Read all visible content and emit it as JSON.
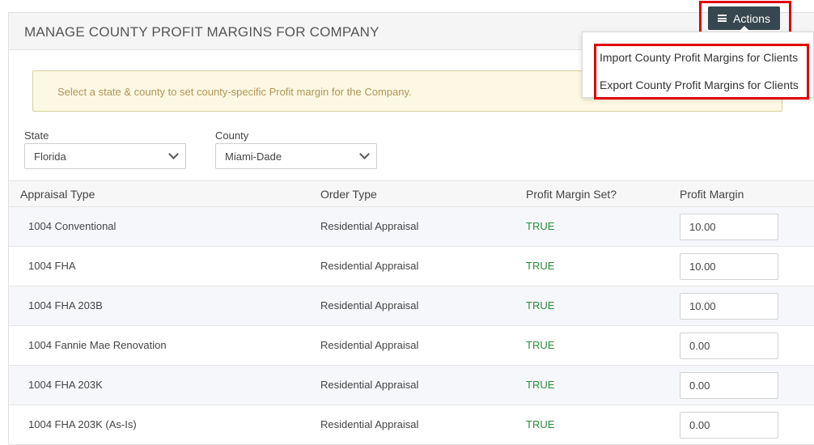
{
  "header": {
    "title": "MANAGE COUNTY PROFIT MARGINS FOR COMPANY",
    "actions_label": "Actions"
  },
  "actions_menu": {
    "items": [
      {
        "label": "Import County Profit Margins for Clients"
      },
      {
        "label": "Export County Profit Margins for Clients"
      }
    ]
  },
  "alert": {
    "text": "Select a state & county to set county-specific Profit margin for the Company."
  },
  "filters": {
    "state_label": "State",
    "state_value": "Florida",
    "county_label": "County",
    "county_value": "Miami-Dade"
  },
  "table": {
    "columns": [
      "Appraisal Type",
      "Order Type",
      "Profit Margin Set?",
      "Profit Margin"
    ],
    "rows": [
      {
        "appraisal_type": "1004 Conventional",
        "order_type": "Residential Appraisal",
        "set": "TRUE",
        "margin": "10.00"
      },
      {
        "appraisal_type": "1004 FHA",
        "order_type": "Residential Appraisal",
        "set": "TRUE",
        "margin": "10.00"
      },
      {
        "appraisal_type": "1004 FHA 203B",
        "order_type": "Residential Appraisal",
        "set": "TRUE",
        "margin": "10.00"
      },
      {
        "appraisal_type": "1004 Fannie Mae Renovation",
        "order_type": "Residential Appraisal",
        "set": "TRUE",
        "margin": "0.00"
      },
      {
        "appraisal_type": "1004 FHA 203K",
        "order_type": "Residential Appraisal",
        "set": "TRUE",
        "margin": "0.00"
      },
      {
        "appraisal_type": "1004 FHA 203K (As-Is)",
        "order_type": "Residential Appraisal",
        "set": "TRUE",
        "margin": "0.00"
      }
    ]
  },
  "colors": {
    "actions_bg": "#37474f",
    "highlight": "#e00000",
    "true_text": "#2a8c3a",
    "alert_bg": "#fcf8e3"
  }
}
